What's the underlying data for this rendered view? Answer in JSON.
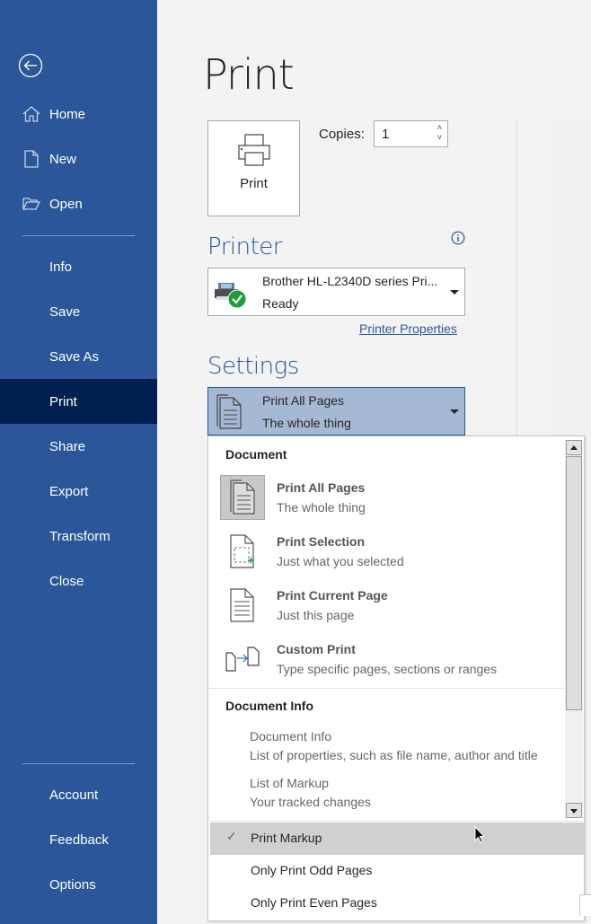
{
  "sidebar": {
    "back_icon": "back-arrow-circle-icon",
    "items": [
      {
        "label": "Home",
        "icon": "home-icon"
      },
      {
        "label": "New",
        "icon": "new-document-icon"
      },
      {
        "label": "Open",
        "icon": "open-folder-icon"
      },
      {
        "label": "Info"
      },
      {
        "label": "Save"
      },
      {
        "label": "Save As"
      },
      {
        "label": "Print",
        "active": true
      },
      {
        "label": "Share"
      },
      {
        "label": "Export"
      },
      {
        "label": "Transform"
      },
      {
        "label": "Close"
      }
    ],
    "bottom_items": [
      {
        "label": "Account"
      },
      {
        "label": "Feedback"
      },
      {
        "label": "Options"
      }
    ]
  },
  "main": {
    "title": "Print",
    "print_button_label": "Print",
    "copies_label": "Copies:",
    "copies_value": "1",
    "printer": {
      "section_title": "Printer",
      "name": "Brother HL-L2340D series Pri...",
      "status": "Ready",
      "properties_link": "Printer Properties"
    },
    "settings": {
      "section_title": "Settings",
      "selected_title": "Print All Pages",
      "selected_desc": "The whole thing"
    }
  },
  "menu": {
    "document_header": "Document",
    "options": [
      {
        "title": "Print All Pages",
        "desc": "The whole thing",
        "selected": true
      },
      {
        "title": "Print Selection",
        "desc": "Just what you selected"
      },
      {
        "title": "Print Current Page",
        "desc": "Just this page"
      },
      {
        "title": "Custom Print",
        "desc": "Type specific pages, sections or ranges"
      }
    ],
    "document_info_header": "Document Info",
    "info_options": [
      {
        "title": "Document Info",
        "desc": "List of properties, such as file name, author and title"
      },
      {
        "title": "List of Markup",
        "desc": "Your tracked changes"
      }
    ],
    "toggles": [
      {
        "label": "Print Markup",
        "checked": true
      },
      {
        "label": "Only Print Odd Pages",
        "checked": false
      },
      {
        "label": "Only Print Even Pages",
        "checked": false
      }
    ],
    "check_glyph": "✓"
  },
  "colors": {
    "brand": "#2b579a",
    "active_nav": "#002050",
    "settings_selected": "#a6b9d4"
  }
}
